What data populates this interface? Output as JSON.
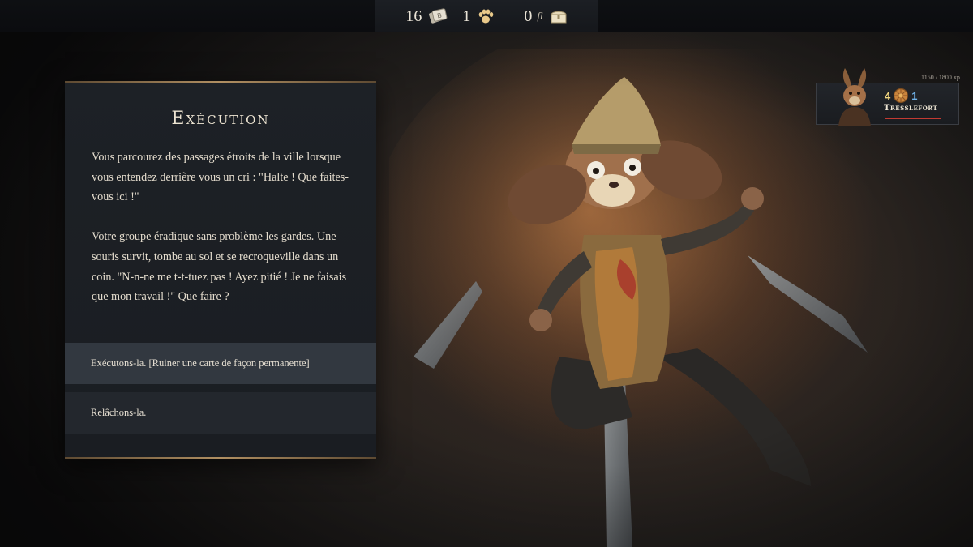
{
  "topbar": {
    "cards_count": "16",
    "cards_icon": "deck-card-icon",
    "paws_count": "1",
    "paws_icon": "paw-icon",
    "gold_count": "0",
    "gold_unit": "fl",
    "chest_icon": "treasure-chest-icon"
  },
  "event": {
    "title": "Exécution",
    "paragraphs": [
      "Vous parcourez des passages étroits de la ville lorsque vous entendez derrière vous un cri : \"Halte ! Que faites-vous ici !\"",
      "Votre groupe éradique sans problème les gardes. Une souris survit, tombe au sol et se recroqueville dans un coin. \"N-n-ne me t-t-tuez pas ! Ayez pitié ! Je ne faisais que mon travail !\" Que faire ?"
    ],
    "choices": [
      "Exécutons-la. [Ruiner une carte de façon permanente]",
      "Relâchons-la."
    ]
  },
  "character": {
    "xp": "1150 / 1800 xp",
    "hp": "4",
    "initiative": "1",
    "name": "Tresslefort",
    "health_fraction": 1.0,
    "portrait_icon": "rabbit-portrait-icon",
    "initiative_icon": "round-shield-icon"
  },
  "colors": {
    "accent_gold": "#b08f62",
    "hp_yellow": "#f2d67e",
    "init_blue": "#6fb3ea",
    "health_red": "#c23a32"
  }
}
